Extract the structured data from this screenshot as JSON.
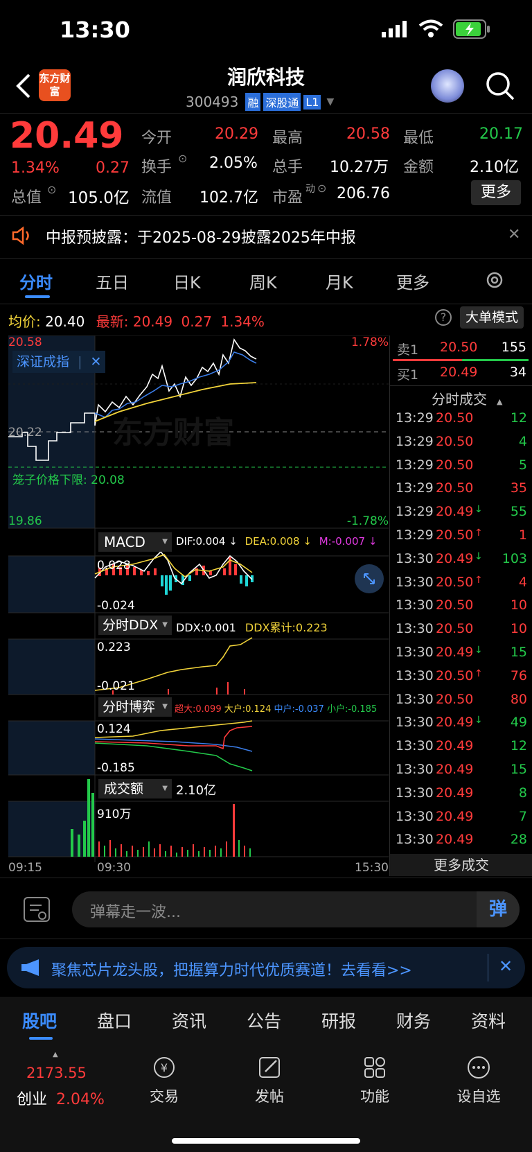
{
  "status_bar": {
    "time": "13:30"
  },
  "header": {
    "logo_text": "东方财富",
    "title": "润欣科技",
    "code": "300493",
    "tags": [
      "融",
      "深股通",
      "L1"
    ]
  },
  "quote": {
    "price": "20.49",
    "change_pct": "1.34%",
    "change": "0.27",
    "rows": [
      {
        "l1": "今开",
        "v1": "20.29",
        "l2": "最高",
        "v2": "20.58",
        "l3": "最低",
        "v3": "20.17"
      },
      {
        "l1": "换手",
        "v1": "2.05%",
        "l2": "总手",
        "v2": "10.27万",
        "l3": "金额",
        "v3": "2.10亿"
      },
      {
        "l1": "总值",
        "v1": "105.0亿",
        "l2": "流值",
        "v2": "102.7亿",
        "l3": "市盈",
        "l3sup": "动",
        "v3": "206.76"
      }
    ],
    "more_label": "更多"
  },
  "notice": {
    "text": "中报预披露：于2025-08-29披露2025年中报"
  },
  "chart_tabs": [
    "分时",
    "五日",
    "日K",
    "周K",
    "月K",
    "更多"
  ],
  "chart_info": {
    "avg_label": "均价:",
    "avg": "20.40",
    "latest_label": "最新:",
    "latest": "20.49",
    "chg": "0.27",
    "pct": "1.34%",
    "mode_label": "大单模式"
  },
  "main_chart": {
    "high": "20.58",
    "low": "19.86",
    "mid": "20.22",
    "pct_high": "1.78%",
    "pct_low": "-1.78%",
    "overlay": "深证成指",
    "limit_label": "笼子价格下限:",
    "limit_value": "20.08",
    "watermark": "东方财富"
  },
  "macd": {
    "label": "MACD",
    "dif": "DIF:0.004 ↓",
    "dea": "DEA:0.008 ↓",
    "m": "M:-0.007 ↓",
    "top": "0.028",
    "bottom": "-0.024"
  },
  "ddx": {
    "label": "分时DDX",
    "ddx": "DDX:0.001",
    "cum": "DDX累计:0.223",
    "top": "0.223",
    "bottom": "-0.021"
  },
  "game": {
    "label": "分时博弈",
    "super": "超大:0.099",
    "big": "大户:0.124",
    "mid": "中户:-0.037",
    "small": "小户:-0.185",
    "top": "0.124",
    "bottom": "-0.185"
  },
  "volume": {
    "label": "成交额",
    "value": "2.10亿",
    "top": "910万"
  },
  "time_axis": {
    "t1": "09:15",
    "t2": "09:30",
    "t3": "15:30"
  },
  "order_book": {
    "sell_label": "卖1",
    "sell_price": "20.50",
    "sell_vol": "155",
    "buy_label": "买1",
    "buy_price": "20.49",
    "buy_vol": "34"
  },
  "ticks_title": "分时成交",
  "ticks": [
    {
      "t": "13:29",
      "p": "20.50",
      "v": "12",
      "vc": "green",
      "a": ""
    },
    {
      "t": "13:29",
      "p": "20.50",
      "v": "4",
      "vc": "green",
      "a": ""
    },
    {
      "t": "13:29",
      "p": "20.50",
      "v": "5",
      "vc": "green",
      "a": ""
    },
    {
      "t": "13:29",
      "p": "20.50",
      "v": "35",
      "vc": "red",
      "a": ""
    },
    {
      "t": "13:29",
      "p": "20.49",
      "v": "55",
      "vc": "green",
      "a": "↓"
    },
    {
      "t": "13:29",
      "p": "20.50",
      "v": "1",
      "vc": "red",
      "a": "↑"
    },
    {
      "t": "13:30",
      "p": "20.49",
      "v": "103",
      "vc": "green",
      "a": "↓"
    },
    {
      "t": "13:30",
      "p": "20.50",
      "v": "4",
      "vc": "red",
      "a": "↑"
    },
    {
      "t": "13:30",
      "p": "20.50",
      "v": "10",
      "vc": "red",
      "a": ""
    },
    {
      "t": "13:30",
      "p": "20.50",
      "v": "10",
      "vc": "red",
      "a": ""
    },
    {
      "t": "13:30",
      "p": "20.49",
      "v": "15",
      "vc": "green",
      "a": "↓"
    },
    {
      "t": "13:30",
      "p": "20.50",
      "v": "76",
      "vc": "red",
      "a": "↑"
    },
    {
      "t": "13:30",
      "p": "20.50",
      "v": "80",
      "vc": "red",
      "a": ""
    },
    {
      "t": "13:30",
      "p": "20.49",
      "v": "49",
      "vc": "green",
      "a": "↓"
    },
    {
      "t": "13:30",
      "p": "20.49",
      "v": "12",
      "vc": "green",
      "a": ""
    },
    {
      "t": "13:30",
      "p": "20.49",
      "v": "15",
      "vc": "green",
      "a": ""
    },
    {
      "t": "13:30",
      "p": "20.49",
      "v": "8",
      "vc": "green",
      "a": ""
    },
    {
      "t": "13:30",
      "p": "20.49",
      "v": "7",
      "vc": "green",
      "a": ""
    },
    {
      "t": "13:30",
      "p": "20.49",
      "v": "28",
      "vc": "green",
      "a": ""
    }
  ],
  "more_ticks": "更多成交",
  "comment": {
    "placeholder": "弹幕走一波...",
    "btn": "弹"
  },
  "ad": {
    "text": "聚焦芯片龙头股，把握算力时代优质赛道！去看看>>"
  },
  "bottom_tabs": [
    "股吧",
    "盘口",
    "资讯",
    "公告",
    "研报",
    "财务",
    "资料"
  ],
  "bottom_bar": {
    "index_value": "2173.55",
    "index_name": "创业",
    "index_pct": "2.04%",
    "items": [
      "交易",
      "发帖",
      "功能",
      "设自选"
    ]
  }
}
